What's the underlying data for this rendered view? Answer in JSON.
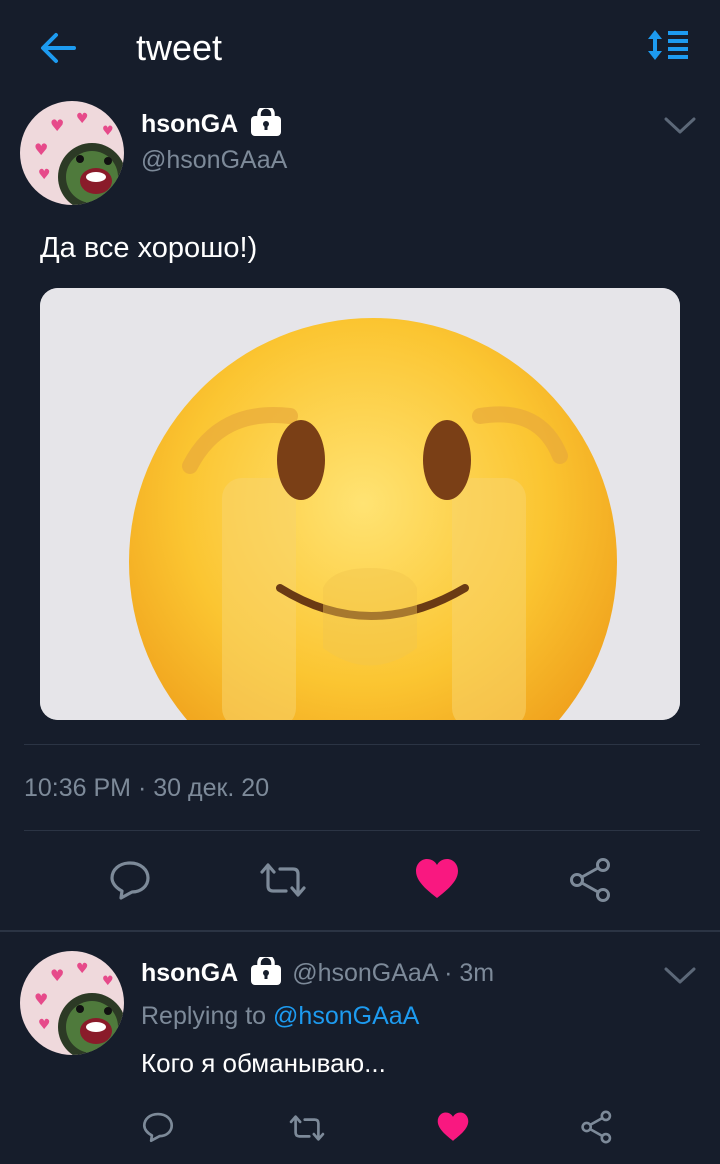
{
  "header": {
    "title": "tweet"
  },
  "tweet": {
    "author_name": "hsonGA",
    "author_handle": "@hsonGAaA",
    "text": "Да все хорошо!)",
    "time": "10:36 PM",
    "date": "30 дек. 20",
    "timestamp": "10:36 PM · 30 дек. 20",
    "liked": true
  },
  "reply": {
    "author_name": "hsonGA",
    "handle_time": "@hsonGAaA · 3m",
    "replying_prefix": "Replying to ",
    "replying_handle": "@hsonGAaA",
    "text": "Кого я обманываю...",
    "liked": true
  },
  "icons": {
    "back": "arrow-left-icon",
    "sort": "sort-icon",
    "lock": "lock-icon",
    "chevron": "chevron-down-icon",
    "reply": "reply-icon",
    "retweet": "retweet-icon",
    "like": "heart-icon",
    "share": "share-icon"
  },
  "colors": {
    "background": "#161d2b",
    "accent": "#1d9bf0",
    "muted": "#7d8a99",
    "like": "#f91880"
  }
}
